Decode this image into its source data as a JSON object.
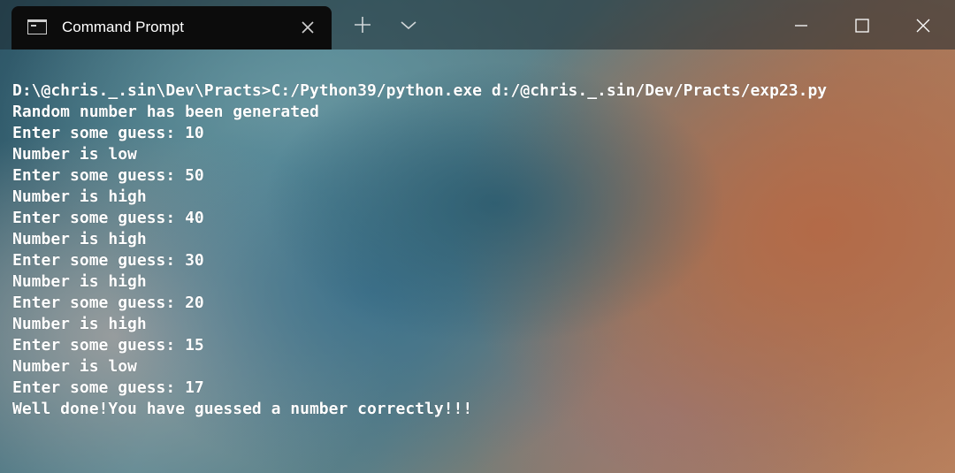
{
  "window": {
    "tab_title": "Command Prompt",
    "tab_icon": "terminal-icon",
    "controls": [
      "new-tab-icon",
      "dropdown-chevron-icon",
      "minimize-icon",
      "maximize-icon",
      "close-icon"
    ]
  },
  "terminal": {
    "lines": [
      "D:\\@chris._.sin\\Dev\\Practs>C:/Python39/python.exe d:/@chris._.sin/Dev/Practs/exp23.py",
      "Random number has been generated",
      "Enter some guess: 10",
      "Number is low",
      "Enter some guess: 50",
      "Number is high",
      "Enter some guess: 40",
      "Number is high",
      "Enter some guess: 30",
      "Number is high",
      "Enter some guess: 20",
      "Number is high",
      "Enter some guess: 15",
      "Number is low",
      "Enter some guess: 17",
      "Well done!You have guessed a number correctly!!!"
    ]
  },
  "colors": {
    "tab_background": "#0c0c0c",
    "text": "#ffffff"
  }
}
